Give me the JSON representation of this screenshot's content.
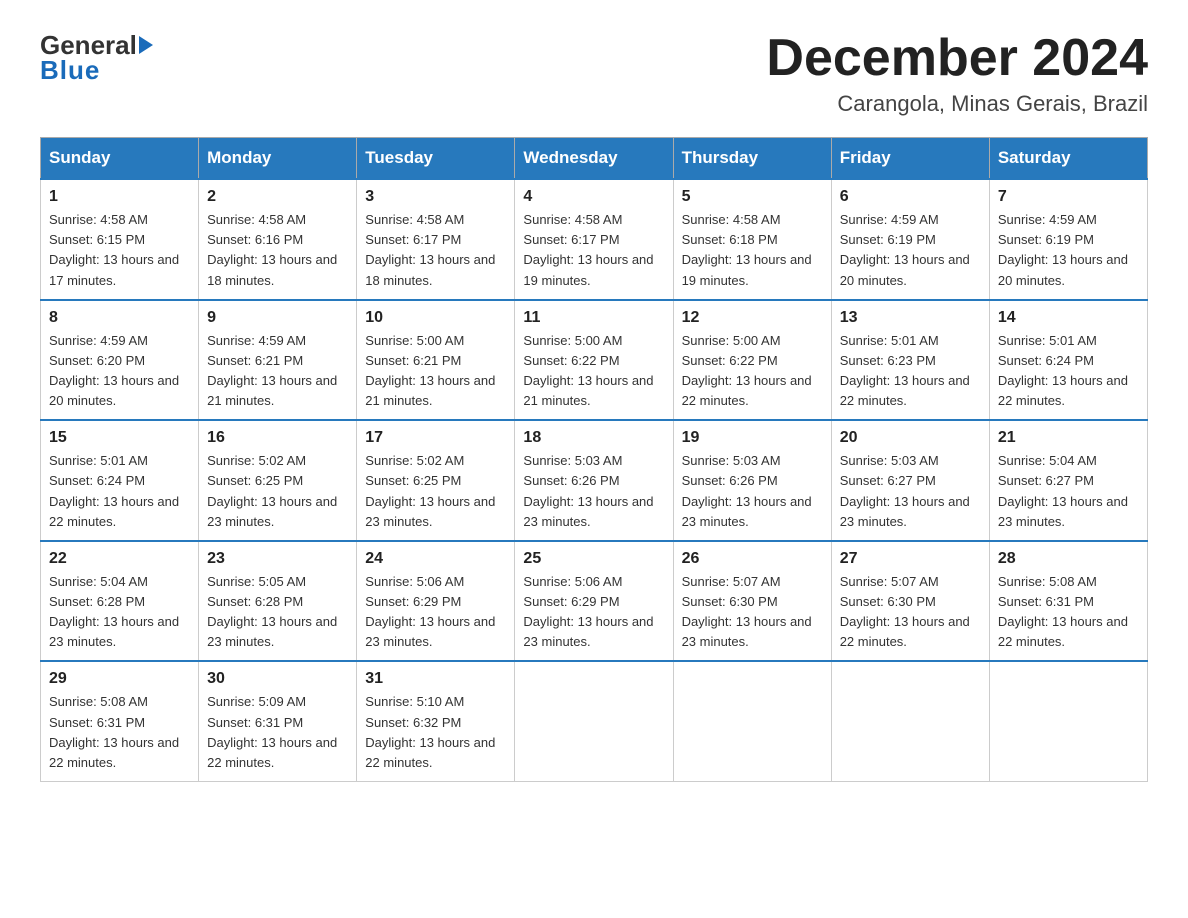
{
  "header": {
    "logo": {
      "general": "General",
      "blue": "Blue"
    },
    "title": "December 2024",
    "location": "Carangola, Minas Gerais, Brazil"
  },
  "days_of_week": [
    "Sunday",
    "Monday",
    "Tuesday",
    "Wednesday",
    "Thursday",
    "Friday",
    "Saturday"
  ],
  "weeks": [
    [
      {
        "num": "1",
        "sunrise": "Sunrise: 4:58 AM",
        "sunset": "Sunset: 6:15 PM",
        "daylight": "Daylight: 13 hours and 17 minutes."
      },
      {
        "num": "2",
        "sunrise": "Sunrise: 4:58 AM",
        "sunset": "Sunset: 6:16 PM",
        "daylight": "Daylight: 13 hours and 18 minutes."
      },
      {
        "num": "3",
        "sunrise": "Sunrise: 4:58 AM",
        "sunset": "Sunset: 6:17 PM",
        "daylight": "Daylight: 13 hours and 18 minutes."
      },
      {
        "num": "4",
        "sunrise": "Sunrise: 4:58 AM",
        "sunset": "Sunset: 6:17 PM",
        "daylight": "Daylight: 13 hours and 19 minutes."
      },
      {
        "num": "5",
        "sunrise": "Sunrise: 4:58 AM",
        "sunset": "Sunset: 6:18 PM",
        "daylight": "Daylight: 13 hours and 19 minutes."
      },
      {
        "num": "6",
        "sunrise": "Sunrise: 4:59 AM",
        "sunset": "Sunset: 6:19 PM",
        "daylight": "Daylight: 13 hours and 20 minutes."
      },
      {
        "num": "7",
        "sunrise": "Sunrise: 4:59 AM",
        "sunset": "Sunset: 6:19 PM",
        "daylight": "Daylight: 13 hours and 20 minutes."
      }
    ],
    [
      {
        "num": "8",
        "sunrise": "Sunrise: 4:59 AM",
        "sunset": "Sunset: 6:20 PM",
        "daylight": "Daylight: 13 hours and 20 minutes."
      },
      {
        "num": "9",
        "sunrise": "Sunrise: 4:59 AM",
        "sunset": "Sunset: 6:21 PM",
        "daylight": "Daylight: 13 hours and 21 minutes."
      },
      {
        "num": "10",
        "sunrise": "Sunrise: 5:00 AM",
        "sunset": "Sunset: 6:21 PM",
        "daylight": "Daylight: 13 hours and 21 minutes."
      },
      {
        "num": "11",
        "sunrise": "Sunrise: 5:00 AM",
        "sunset": "Sunset: 6:22 PM",
        "daylight": "Daylight: 13 hours and 21 minutes."
      },
      {
        "num": "12",
        "sunrise": "Sunrise: 5:00 AM",
        "sunset": "Sunset: 6:22 PM",
        "daylight": "Daylight: 13 hours and 22 minutes."
      },
      {
        "num": "13",
        "sunrise": "Sunrise: 5:01 AM",
        "sunset": "Sunset: 6:23 PM",
        "daylight": "Daylight: 13 hours and 22 minutes."
      },
      {
        "num": "14",
        "sunrise": "Sunrise: 5:01 AM",
        "sunset": "Sunset: 6:24 PM",
        "daylight": "Daylight: 13 hours and 22 minutes."
      }
    ],
    [
      {
        "num": "15",
        "sunrise": "Sunrise: 5:01 AM",
        "sunset": "Sunset: 6:24 PM",
        "daylight": "Daylight: 13 hours and 22 minutes."
      },
      {
        "num": "16",
        "sunrise": "Sunrise: 5:02 AM",
        "sunset": "Sunset: 6:25 PM",
        "daylight": "Daylight: 13 hours and 23 minutes."
      },
      {
        "num": "17",
        "sunrise": "Sunrise: 5:02 AM",
        "sunset": "Sunset: 6:25 PM",
        "daylight": "Daylight: 13 hours and 23 minutes."
      },
      {
        "num": "18",
        "sunrise": "Sunrise: 5:03 AM",
        "sunset": "Sunset: 6:26 PM",
        "daylight": "Daylight: 13 hours and 23 minutes."
      },
      {
        "num": "19",
        "sunrise": "Sunrise: 5:03 AM",
        "sunset": "Sunset: 6:26 PM",
        "daylight": "Daylight: 13 hours and 23 minutes."
      },
      {
        "num": "20",
        "sunrise": "Sunrise: 5:03 AM",
        "sunset": "Sunset: 6:27 PM",
        "daylight": "Daylight: 13 hours and 23 minutes."
      },
      {
        "num": "21",
        "sunrise": "Sunrise: 5:04 AM",
        "sunset": "Sunset: 6:27 PM",
        "daylight": "Daylight: 13 hours and 23 minutes."
      }
    ],
    [
      {
        "num": "22",
        "sunrise": "Sunrise: 5:04 AM",
        "sunset": "Sunset: 6:28 PM",
        "daylight": "Daylight: 13 hours and 23 minutes."
      },
      {
        "num": "23",
        "sunrise": "Sunrise: 5:05 AM",
        "sunset": "Sunset: 6:28 PM",
        "daylight": "Daylight: 13 hours and 23 minutes."
      },
      {
        "num": "24",
        "sunrise": "Sunrise: 5:06 AM",
        "sunset": "Sunset: 6:29 PM",
        "daylight": "Daylight: 13 hours and 23 minutes."
      },
      {
        "num": "25",
        "sunrise": "Sunrise: 5:06 AM",
        "sunset": "Sunset: 6:29 PM",
        "daylight": "Daylight: 13 hours and 23 minutes."
      },
      {
        "num": "26",
        "sunrise": "Sunrise: 5:07 AM",
        "sunset": "Sunset: 6:30 PM",
        "daylight": "Daylight: 13 hours and 23 minutes."
      },
      {
        "num": "27",
        "sunrise": "Sunrise: 5:07 AM",
        "sunset": "Sunset: 6:30 PM",
        "daylight": "Daylight: 13 hours and 22 minutes."
      },
      {
        "num": "28",
        "sunrise": "Sunrise: 5:08 AM",
        "sunset": "Sunset: 6:31 PM",
        "daylight": "Daylight: 13 hours and 22 minutes."
      }
    ],
    [
      {
        "num": "29",
        "sunrise": "Sunrise: 5:08 AM",
        "sunset": "Sunset: 6:31 PM",
        "daylight": "Daylight: 13 hours and 22 minutes."
      },
      {
        "num": "30",
        "sunrise": "Sunrise: 5:09 AM",
        "sunset": "Sunset: 6:31 PM",
        "daylight": "Daylight: 13 hours and 22 minutes."
      },
      {
        "num": "31",
        "sunrise": "Sunrise: 5:10 AM",
        "sunset": "Sunset: 6:32 PM",
        "daylight": "Daylight: 13 hours and 22 minutes."
      },
      null,
      null,
      null,
      null
    ]
  ]
}
